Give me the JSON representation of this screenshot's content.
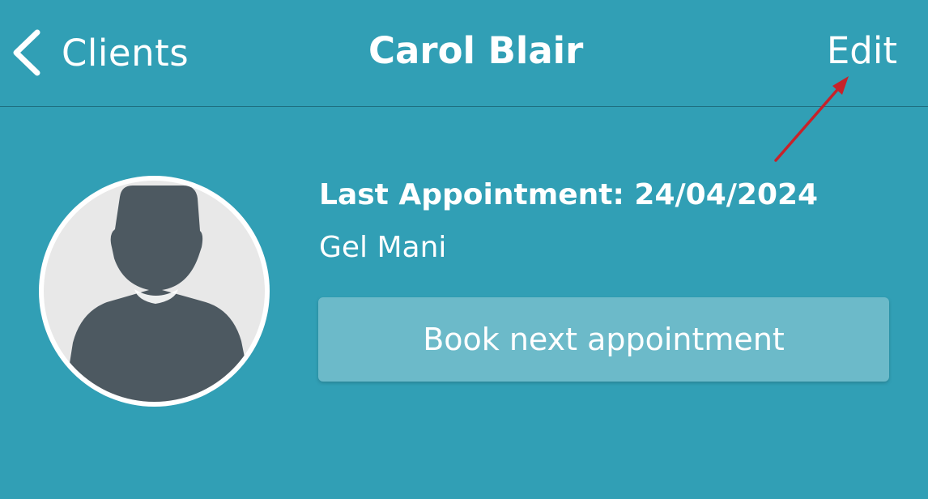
{
  "header": {
    "back_label": "Clients",
    "title": "Carol Blair",
    "edit_label": "Edit"
  },
  "client": {
    "last_appointment": "Last Appointment: 24/04/2024",
    "service": "Gel Mani"
  },
  "actions": {
    "book_label": "Book next appointment"
  },
  "colors": {
    "background": "#319fb5",
    "button": "#6cbac9",
    "avatar_fill": "#4d5961",
    "annotation_arrow": "#c8222a"
  }
}
